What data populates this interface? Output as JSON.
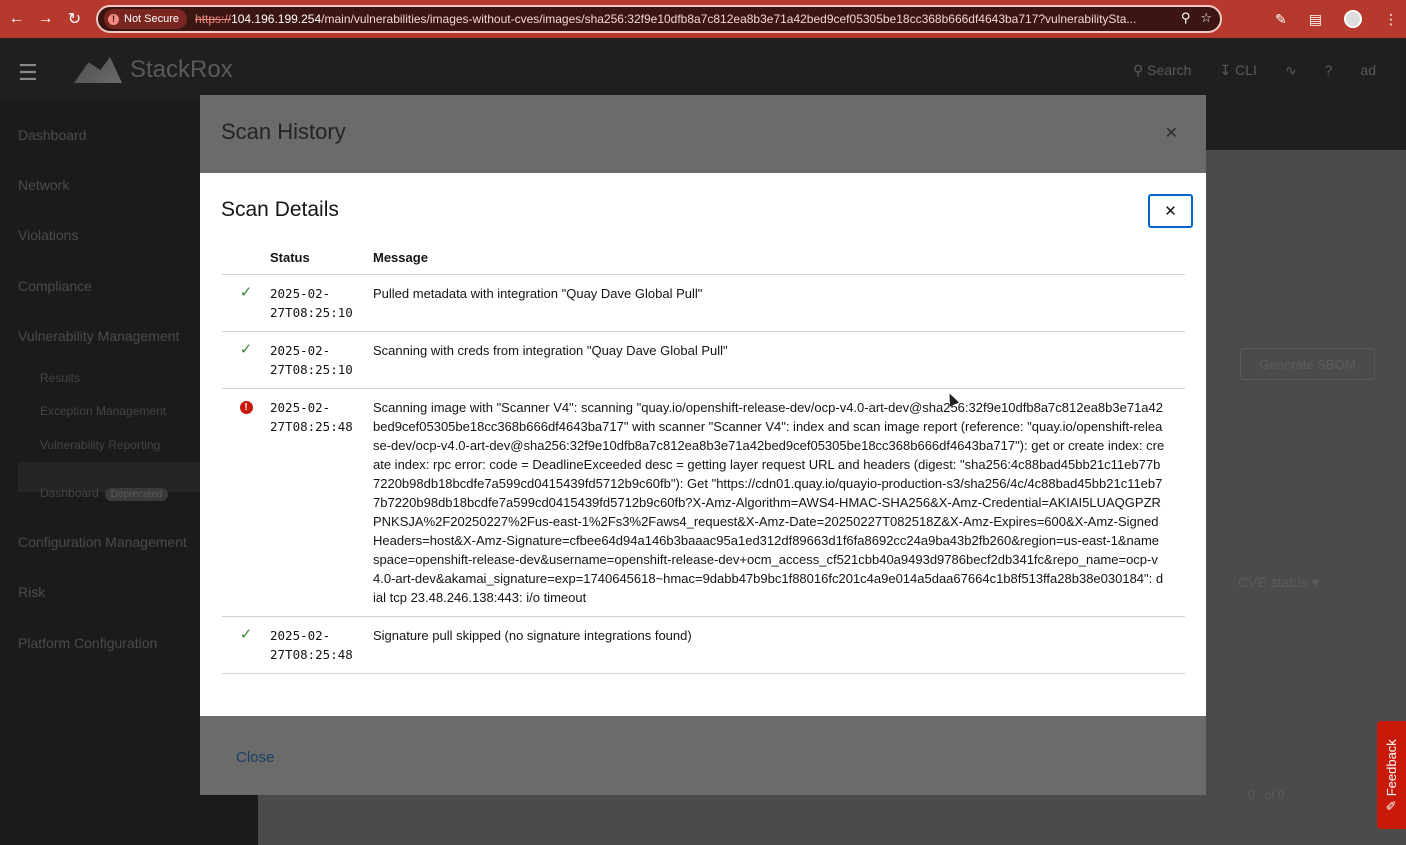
{
  "browser": {
    "security_label": "Not Secure",
    "url_scheme": "https://",
    "url_host": "104.196.199.254",
    "url_path": "/main/vulnerabilities/images-without-cves/images/sha256:32f9e10dfb8a7c812ea8b3e71a42bed9cef05305be18cc368b666df4643ba717?vulnerabilitySta..."
  },
  "app": {
    "logo_text": "StackRox",
    "masthead": {
      "search_label": "Search",
      "cli_label": "CLI",
      "user_initials": "ad"
    },
    "sidebar": {
      "items": [
        "Dashboard",
        "Network",
        "Violations",
        "Compliance",
        "Vulnerability Management",
        "Configuration Management",
        "Risk",
        "Platform Configuration"
      ],
      "sub_items": [
        "Results",
        "Exception Management",
        "Vulnerability Reporting"
      ],
      "dashboard_label": "Dashboard",
      "deprecated_badge": "Deprecated"
    },
    "generate_sbom_label": "Generate SBOM",
    "cve_status_label": "CVE status",
    "pager_of": "of 0",
    "pager_page": "0",
    "feedback_label": "Feedback"
  },
  "scan_history": {
    "title": "Scan History",
    "close_link": "Close"
  },
  "scan_details": {
    "title": "Scan Details",
    "columns": {
      "status": "Status",
      "message": "Message"
    },
    "rows": [
      {
        "state": "success",
        "status_line1": "2025-02-",
        "status_line2": "27T08:25:10",
        "message": "Pulled metadata with integration \"Quay Dave Global Pull\""
      },
      {
        "state": "success",
        "status_line1": "2025-02-",
        "status_line2": "27T08:25:10",
        "message": "Scanning with creds from integration \"Quay Dave Global Pull\""
      },
      {
        "state": "error",
        "status_line1": "2025-02-",
        "status_line2": "27T08:25:48",
        "message": "Scanning image with \"Scanner V4\": scanning \"quay.io/openshift-release-dev/ocp-v4.0-art-dev@sha256:32f9e10dfb8a7c812ea8b3e71a42bed9cef05305be18cc368b666df4643ba717\" with scanner \"Scanner V4\": index and scan image report (reference: \"quay.io/openshift-release-dev/ocp-v4.0-art-dev@sha256:32f9e10dfb8a7c812ea8b3e71a42bed9cef05305be18cc368b666df4643ba717\"): get or create index: create index: rpc error: code = DeadlineExceeded desc = getting layer request URL and headers (digest: \"sha256:4c88bad45bb21c11eb77b7220b98db18bcdfe7a599cd0415439fd5712b9c60fb\"): Get \"https://cdn01.quay.io/quayio-production-s3/sha256/4c/4c88bad45bb21c11eb77b7220b98db18bcdfe7a599cd0415439fd5712b9c60fb?X-Amz-Algorithm=AWS4-HMAC-SHA256&X-Amz-Credential=AKIAI5LUAQGPZRPNKSJA%2F20250227%2Fus-east-1%2Fs3%2Faws4_request&X-Amz-Date=20250227T082518Z&X-Amz-Expires=600&X-Amz-SignedHeaders=host&X-Amz-Signature=cfbee64d94a146b3baaac95a1ed312df89663d1f6fa8692cc24a9ba43b2fb260&region=us-east-1&namespace=openshift-release-dev&username=openshift-release-dev+ocm_access_cf521cbb40a9493d9786becf2db341fc&repo_name=ocp-v4.0-art-dev&akamai_signature=exp=1740645618~hmac=9dabb47b9bc1f88016fc201c4a9e014a5daa67664c1b8f513ffa28b38e030184\": dial tcp 23.48.246.138:443: i/o timeout"
      },
      {
        "state": "success",
        "status_line1": "2025-02-",
        "status_line2": "27T08:25:48",
        "message": "Signature pull skipped (no signature integrations found)"
      }
    ]
  },
  "colors": {
    "success": "#3e8635",
    "danger": "#c9190b",
    "focus": "#0066cc",
    "chrome": "#b5392c"
  },
  "icons": [
    "back-icon",
    "forward-icon",
    "reload-icon",
    "warning-icon",
    "zoom-icon",
    "star-icon",
    "extensions-icon",
    "sidebar-icon",
    "profile-icon",
    "menu-icon",
    "close-icon",
    "check-icon",
    "error-icon",
    "search-icon",
    "download-icon",
    "help-icon",
    "feedback-icon"
  ]
}
